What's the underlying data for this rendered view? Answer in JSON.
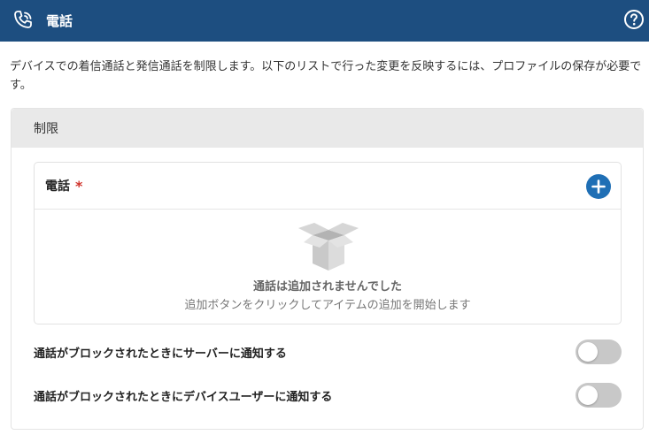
{
  "header": {
    "title": "電話",
    "icon": "phone-call-icon",
    "help_icon": "help-circle-icon",
    "background": "#1d4e80"
  },
  "description": "デバイスでの着信通話と発信通話を制限します。以下のリストで行った変更を反映するには、プロファイルの保存が必要です。",
  "section": {
    "title": "制限",
    "phone_list": {
      "label": "電話",
      "required_mark": "*",
      "add_icon": "plus-circle-icon",
      "empty_icon": "empty-box-icon",
      "empty_title": "通話は追加されませんでした",
      "empty_hint": "追加ボタンをクリックしてアイテムの追加を開始します"
    },
    "toggles": [
      {
        "label": "通話がブロックされたときにサーバーに通知する",
        "enabled": false
      },
      {
        "label": "通話がブロックされたときにデバイスユーザーに通知する",
        "enabled": false
      }
    ]
  },
  "colors": {
    "accent": "#1f6fb5",
    "required": "#d0342c",
    "toggle_off": "#c8c8c8"
  }
}
